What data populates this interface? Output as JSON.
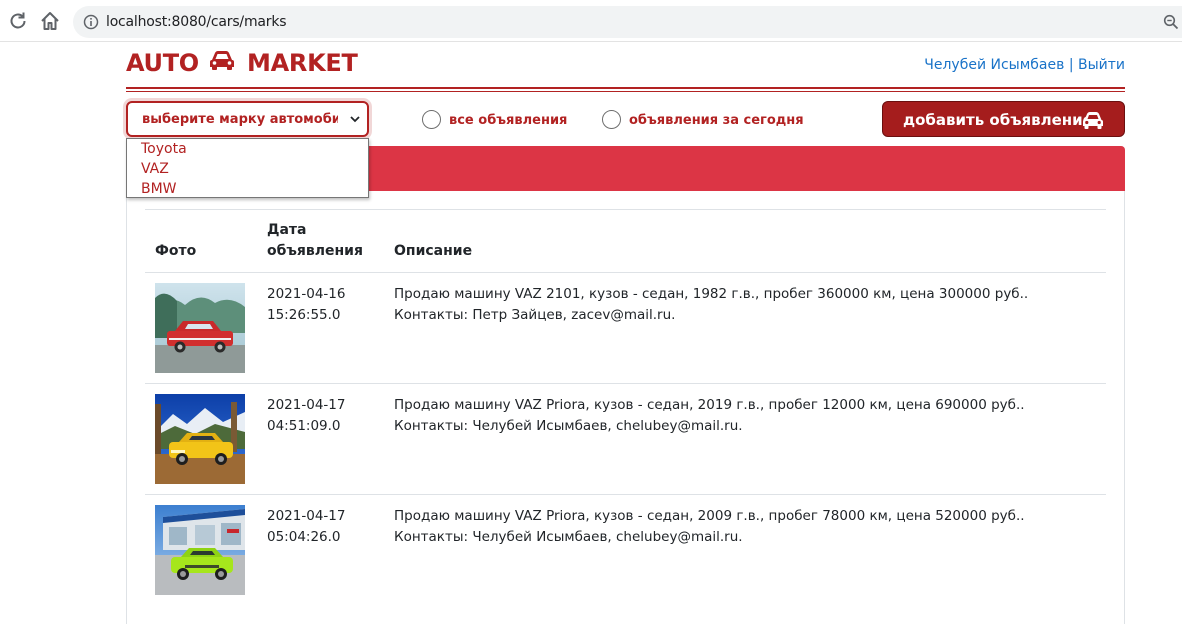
{
  "browser": {
    "url": "localhost:8080/cars/marks"
  },
  "header": {
    "brand_left": "AUTO",
    "brand_right": "MARKET",
    "user_name": "Челубей Исымбаев",
    "separator": "|",
    "logout": "Выйти"
  },
  "filters": {
    "brand_select": {
      "selected": "выберите марку автомобиля",
      "options": [
        "Toyota",
        "VAZ",
        "BMW"
      ]
    },
    "radio_all": "все объявления",
    "radio_today": "объявления за сегодня",
    "add_button": "добавить объявление"
  },
  "table": {
    "headers": {
      "photo": "Фото",
      "date": "Дата объявления",
      "description": "Описание"
    },
    "rows": [
      {
        "date_line1": "2021-04-16",
        "date_line2": "15:26:55.0",
        "description": "Продаю машину VAZ 2101, кузов - седан, 1982 г.в., пробег 360000 км, цена 300000 руб.. Контакты: Петр Зайцев, zacev@mail.ru."
      },
      {
        "date_line1": "2021-04-17",
        "date_line2": "04:51:09.0",
        "description": "Продаю машину VAZ Priora, кузов - седан, 2019 г.в., пробег 12000 км, цена 690000 руб.. Контакты: Челубей Исымбаев, chelubey@mail.ru."
      },
      {
        "date_line1": "2021-04-17",
        "date_line2": "05:04:26.0",
        "description": "Продаю машину VAZ Priora, кузов - седан, 2009 г.в., пробег 78000 км, цена 520000 руб.. Контакты: Челубей Исымбаев, chelubey@mail.ru."
      }
    ]
  },
  "icons": {
    "brand_logo": "car-icon",
    "add_button": "car-icon",
    "select_arrow": "chevron-down-icon",
    "reload": "reload-icon",
    "home": "home-icon",
    "site_info": "info-icon",
    "zoom": "zoom-icon"
  },
  "colors": {
    "brand_red": "#b22222",
    "card_header_red": "#dc3545",
    "button_red": "#a51d1d",
    "link_blue": "#1a73c8"
  }
}
